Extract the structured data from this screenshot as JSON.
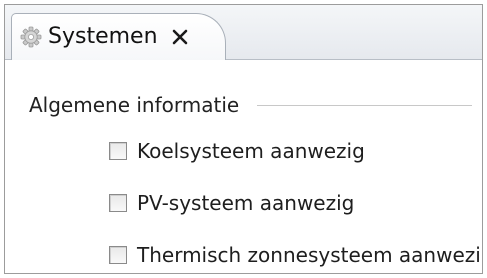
{
  "tab": {
    "label": "Systemen",
    "icon": "gear-icon",
    "close_icon": "close-icon"
  },
  "group": {
    "title": "Algemene informatie"
  },
  "checkboxes": [
    {
      "label": "Koelsysteem aanwezig",
      "checked": false
    },
    {
      "label": "PV-systeem aanwezig",
      "checked": false
    },
    {
      "label": "Thermisch zonnesysteem aanwezig",
      "checked": false
    }
  ]
}
